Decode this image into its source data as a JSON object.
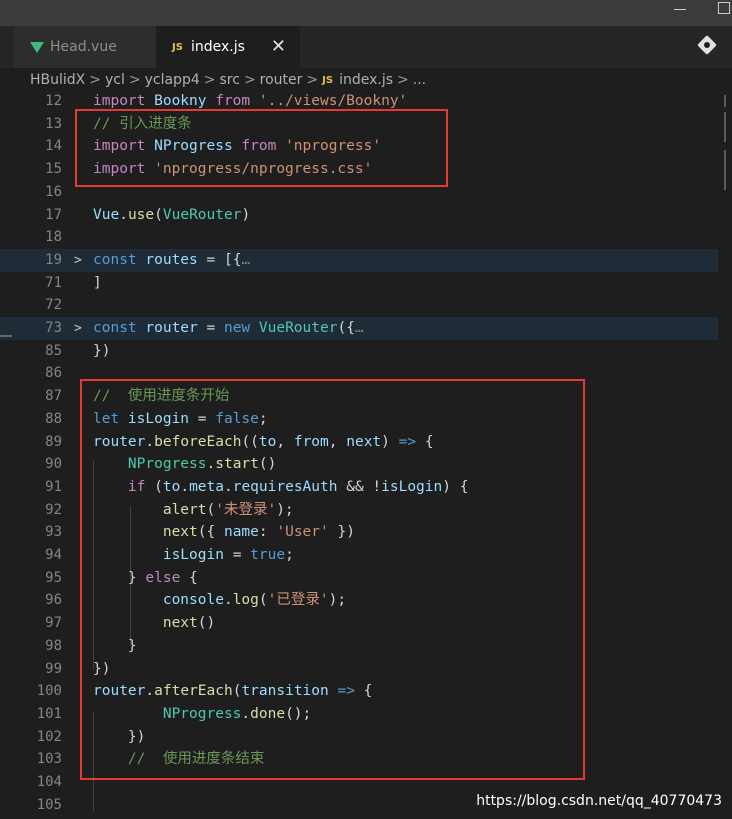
{
  "tabs": [
    {
      "label": "Head.vue",
      "icon": "vue-icon",
      "active": false
    },
    {
      "label": "index.js",
      "icon": "js-icon",
      "active": true
    }
  ],
  "tab_icon_text": "JS",
  "close_glyph": "✕",
  "breadcrumb": [
    "HBulidX",
    "ycl",
    "yclapp4",
    "src",
    "router",
    "index.js",
    "..."
  ],
  "breadcrumb_sep": ">",
  "lines": [
    {
      "n": "12",
      "tokens": [
        [
          "k",
          "import "
        ],
        [
          "v",
          "Bookny "
        ],
        [
          "k",
          "from "
        ],
        [
          "s",
          "'../views/Bookny'"
        ]
      ]
    },
    {
      "n": "13",
      "tokens": [
        [
          "c",
          "// 引入进度条"
        ]
      ]
    },
    {
      "n": "14",
      "tokens": [
        [
          "k",
          "import "
        ],
        [
          "v",
          "NProgress "
        ],
        [
          "k",
          "from "
        ],
        [
          "s",
          "'nprogress'"
        ]
      ]
    },
    {
      "n": "15",
      "tokens": [
        [
          "k",
          "import "
        ],
        [
          "s",
          "'nprogress/nprogress.css'"
        ]
      ]
    },
    {
      "n": "16",
      "tokens": []
    },
    {
      "n": "17",
      "tokens": [
        [
          "v",
          "Vue"
        ],
        [
          "p",
          "."
        ],
        [
          "f",
          "use"
        ],
        [
          "p",
          "("
        ],
        [
          "t",
          "VueRouter"
        ],
        [
          "p",
          ")"
        ]
      ]
    },
    {
      "n": "18",
      "tokens": []
    },
    {
      "n": "19",
      "fold": true,
      "highlight": true,
      "tokens": [
        [
          "b",
          "const "
        ],
        [
          "v",
          "routes "
        ],
        [
          "p",
          "= [{"
        ],
        [
          "dim",
          "…"
        ]
      ]
    },
    {
      "n": "71",
      "tokens": [
        [
          "p",
          "]"
        ]
      ]
    },
    {
      "n": "72",
      "tokens": []
    },
    {
      "n": "73",
      "fold": true,
      "highlight": true,
      "tokens": [
        [
          "b",
          "const "
        ],
        [
          "v",
          "router "
        ],
        [
          "p",
          "= "
        ],
        [
          "b",
          "new "
        ],
        [
          "t",
          "VueRouter"
        ],
        [
          "p",
          "({"
        ],
        [
          "dim",
          "…"
        ]
      ]
    },
    {
      "n": "85",
      "tokens": [
        [
          "p",
          "})"
        ]
      ]
    },
    {
      "n": "86",
      "tokens": []
    },
    {
      "n": "87",
      "tokens": [
        [
          "c",
          "//  使用进度条开始"
        ]
      ]
    },
    {
      "n": "88",
      "tokens": [
        [
          "b",
          "let "
        ],
        [
          "v",
          "isLogin "
        ],
        [
          "p",
          "= "
        ],
        [
          "b",
          "false"
        ],
        [
          "p",
          ";"
        ]
      ]
    },
    {
      "n": "89",
      "tokens": [
        [
          "v",
          "router"
        ],
        [
          "p",
          "."
        ],
        [
          "f",
          "beforeEach"
        ],
        [
          "p",
          "(("
        ],
        [
          "v",
          "to"
        ],
        [
          "p",
          ", "
        ],
        [
          "v",
          "from"
        ],
        [
          "p",
          ", "
        ],
        [
          "v",
          "next"
        ],
        [
          "p",
          ") "
        ],
        [
          "b",
          "=> "
        ],
        [
          "p",
          "{"
        ]
      ]
    },
    {
      "n": "90",
      "tokens": [
        [
          "p",
          "    "
        ],
        [
          "t",
          "NProgress"
        ],
        [
          "p",
          "."
        ],
        [
          "f",
          "start"
        ],
        [
          "p",
          "()"
        ]
      ]
    },
    {
      "n": "91",
      "tokens": [
        [
          "p",
          "    "
        ],
        [
          "k",
          "if "
        ],
        [
          "p",
          "("
        ],
        [
          "v",
          "to"
        ],
        [
          "p",
          "."
        ],
        [
          "v",
          "meta"
        ],
        [
          "p",
          "."
        ],
        [
          "v",
          "requiresAuth "
        ],
        [
          "p",
          "&& !"
        ],
        [
          "v",
          "isLogin"
        ],
        [
          "p",
          ") {"
        ]
      ]
    },
    {
      "n": "92",
      "tokens": [
        [
          "p",
          "        "
        ],
        [
          "f",
          "alert"
        ],
        [
          "p",
          "("
        ],
        [
          "s",
          "'未登录'"
        ],
        [
          "p",
          ");"
        ]
      ]
    },
    {
      "n": "93",
      "tokens": [
        [
          "p",
          "        "
        ],
        [
          "f",
          "next"
        ],
        [
          "p",
          "({ "
        ],
        [
          "v",
          "name"
        ],
        [
          "p",
          ": "
        ],
        [
          "s",
          "'User' "
        ],
        [
          "p",
          "})"
        ]
      ]
    },
    {
      "n": "94",
      "tokens": [
        [
          "p",
          "        "
        ],
        [
          "v",
          "isLogin "
        ],
        [
          "p",
          "= "
        ],
        [
          "b",
          "true"
        ],
        [
          "p",
          ";"
        ]
      ]
    },
    {
      "n": "95",
      "tokens": [
        [
          "p",
          "    } "
        ],
        [
          "k",
          "else "
        ],
        [
          "p",
          "{"
        ]
      ]
    },
    {
      "n": "96",
      "tokens": [
        [
          "p",
          "        "
        ],
        [
          "v",
          "console"
        ],
        [
          "p",
          "."
        ],
        [
          "f",
          "log"
        ],
        [
          "p",
          "("
        ],
        [
          "s",
          "'已登录'"
        ],
        [
          "p",
          ");"
        ]
      ]
    },
    {
      "n": "97",
      "tokens": [
        [
          "p",
          "        "
        ],
        [
          "f",
          "next"
        ],
        [
          "p",
          "()"
        ]
      ]
    },
    {
      "n": "98",
      "tokens": [
        [
          "p",
          "    }"
        ]
      ]
    },
    {
      "n": "99",
      "tokens": [
        [
          "p",
          "})"
        ]
      ]
    },
    {
      "n": "100",
      "tokens": [
        [
          "v",
          "router"
        ],
        [
          "p",
          "."
        ],
        [
          "f",
          "afterEach"
        ],
        [
          "p",
          "("
        ],
        [
          "v",
          "transition "
        ],
        [
          "b",
          "=> "
        ],
        [
          "p",
          "{"
        ]
      ]
    },
    {
      "n": "101",
      "tokens": [
        [
          "p",
          "        "
        ],
        [
          "t",
          "NProgress"
        ],
        [
          "p",
          "."
        ],
        [
          "f",
          "done"
        ],
        [
          "p",
          "();"
        ]
      ]
    },
    {
      "n": "102",
      "tokens": [
        [
          "p",
          "    })"
        ]
      ]
    },
    {
      "n": "103",
      "tokens": [
        [
          "p",
          "    "
        ],
        [
          "c",
          "//  使用进度条结束"
        ]
      ]
    },
    {
      "n": "104",
      "tokens": []
    },
    {
      "n": "105",
      "tokens": []
    }
  ],
  "watermark": "https://blog.csdn.net/qq_40770473"
}
